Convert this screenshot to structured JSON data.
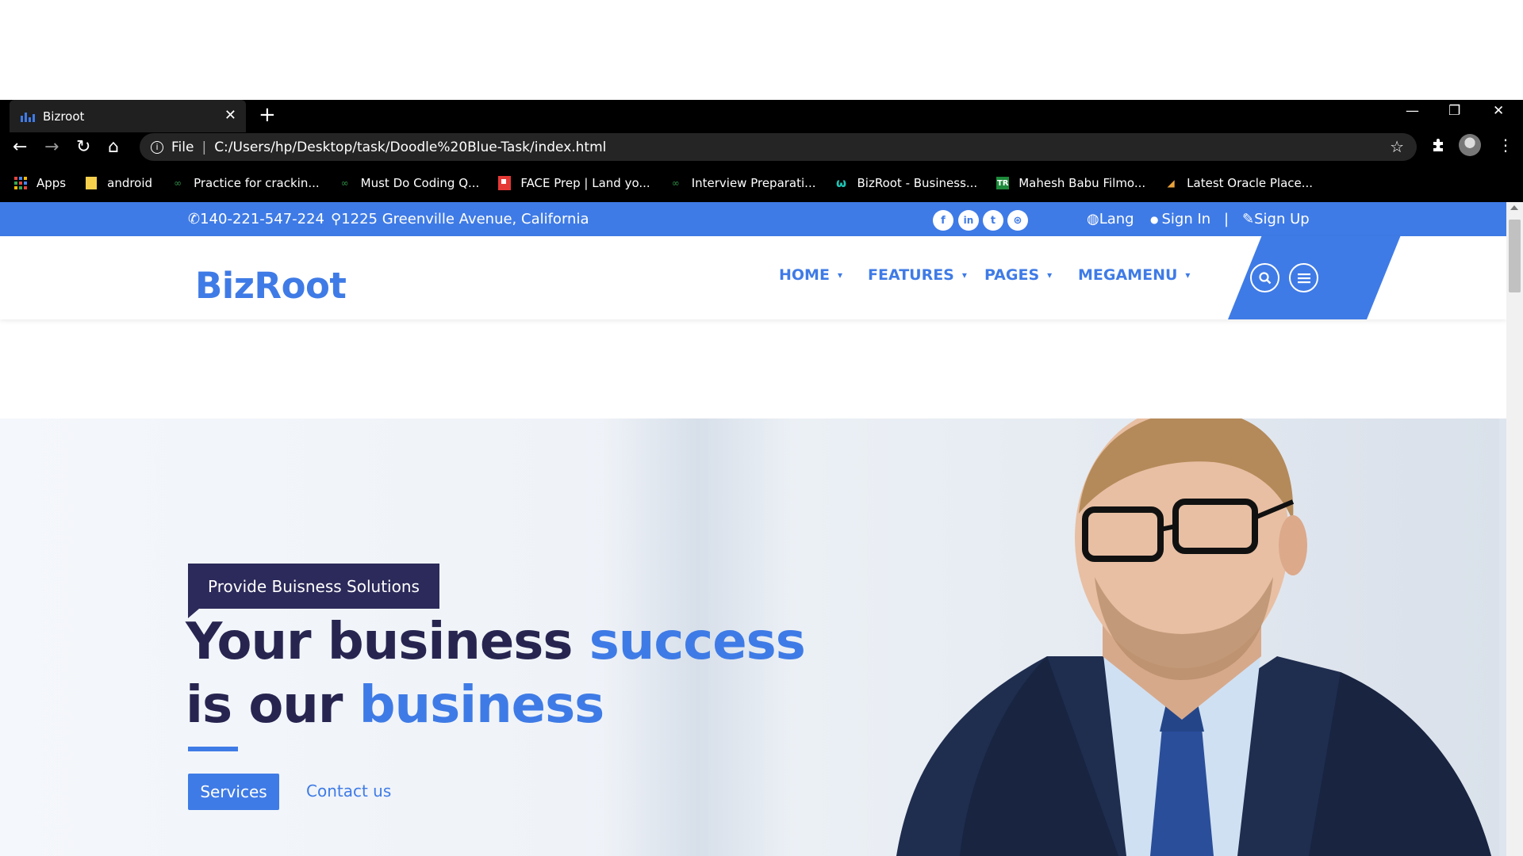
{
  "browser": {
    "tab_title": "Bizroot",
    "tab_close": "✕",
    "new_tab": "+",
    "window_controls": {
      "minimize": "—",
      "restore": "❐",
      "close": "✕"
    },
    "nav": {
      "back": "←",
      "forward": "→",
      "reload": "↻",
      "home": "⌂"
    },
    "address": {
      "info": "i",
      "scheme_label": "File",
      "separator": "|",
      "url": "C:/Users/hp/Desktop/task/Doodle%20Blue-Task/index.html",
      "star": "☆"
    },
    "extensions_icon": "puzzle-icon",
    "menu_icon": "⋮",
    "bookmarks": [
      {
        "label": "Apps",
        "icon": "apps-grid-icon"
      },
      {
        "label": "android",
        "icon": "folder-icon"
      },
      {
        "label": "Practice for crackin...",
        "icon": "gfg-icon"
      },
      {
        "label": "Must Do Coding Q...",
        "icon": "gfg-icon"
      },
      {
        "label": "FACE Prep | Land yo...",
        "icon": "faceprep-icon"
      },
      {
        "label": "Interview Preparati...",
        "icon": "gfg-icon"
      },
      {
        "label": "BizRoot - Business...",
        "icon": "bizroot-icon"
      },
      {
        "label": "Mahesh Babu Filmo...",
        "icon": "tr-icon"
      },
      {
        "label": "Latest Oracle Place...",
        "icon": "oracle-icon"
      }
    ]
  },
  "site": {
    "accent": "#3f7be6",
    "dark": "#2c2a5a",
    "topbar": {
      "phone_icon": "✆",
      "phone": "140-221-547-224",
      "address_icon": "⚲",
      "address": "1225 Greenville Avenue, California",
      "social": [
        {
          "label": "f",
          "icon": "facebook-icon"
        },
        {
          "label": "in",
          "icon": "linkedin-icon"
        },
        {
          "label": "t",
          "icon": "twitter-icon"
        },
        {
          "label": "⊛",
          "icon": "dribbble-icon"
        }
      ],
      "lang_icon": "◍",
      "lang": "Lang",
      "signin_icon": "●",
      "signin": "Sign In",
      "divider": "|",
      "signup_icon": "✎",
      "signup": "Sign Up"
    },
    "header": {
      "logo": "BizRoot",
      "menu": [
        {
          "label": "HOME",
          "chevron": "▾"
        },
        {
          "label": "FEATURES",
          "chevron": "▾"
        },
        {
          "label": "PAGES",
          "chevron": "▾"
        },
        {
          "label": "MEGAMENU",
          "chevron": "▾"
        }
      ],
      "search_icon": "⌕",
      "menu_icon": "≡"
    },
    "hero": {
      "badge": "Provide Buisness Solutions",
      "line1_a": "Your business ",
      "line1_b": "success",
      "line2_a": "is our ",
      "line2_b": "business",
      "primary_button": "Services",
      "secondary_link": "Contact us"
    }
  }
}
